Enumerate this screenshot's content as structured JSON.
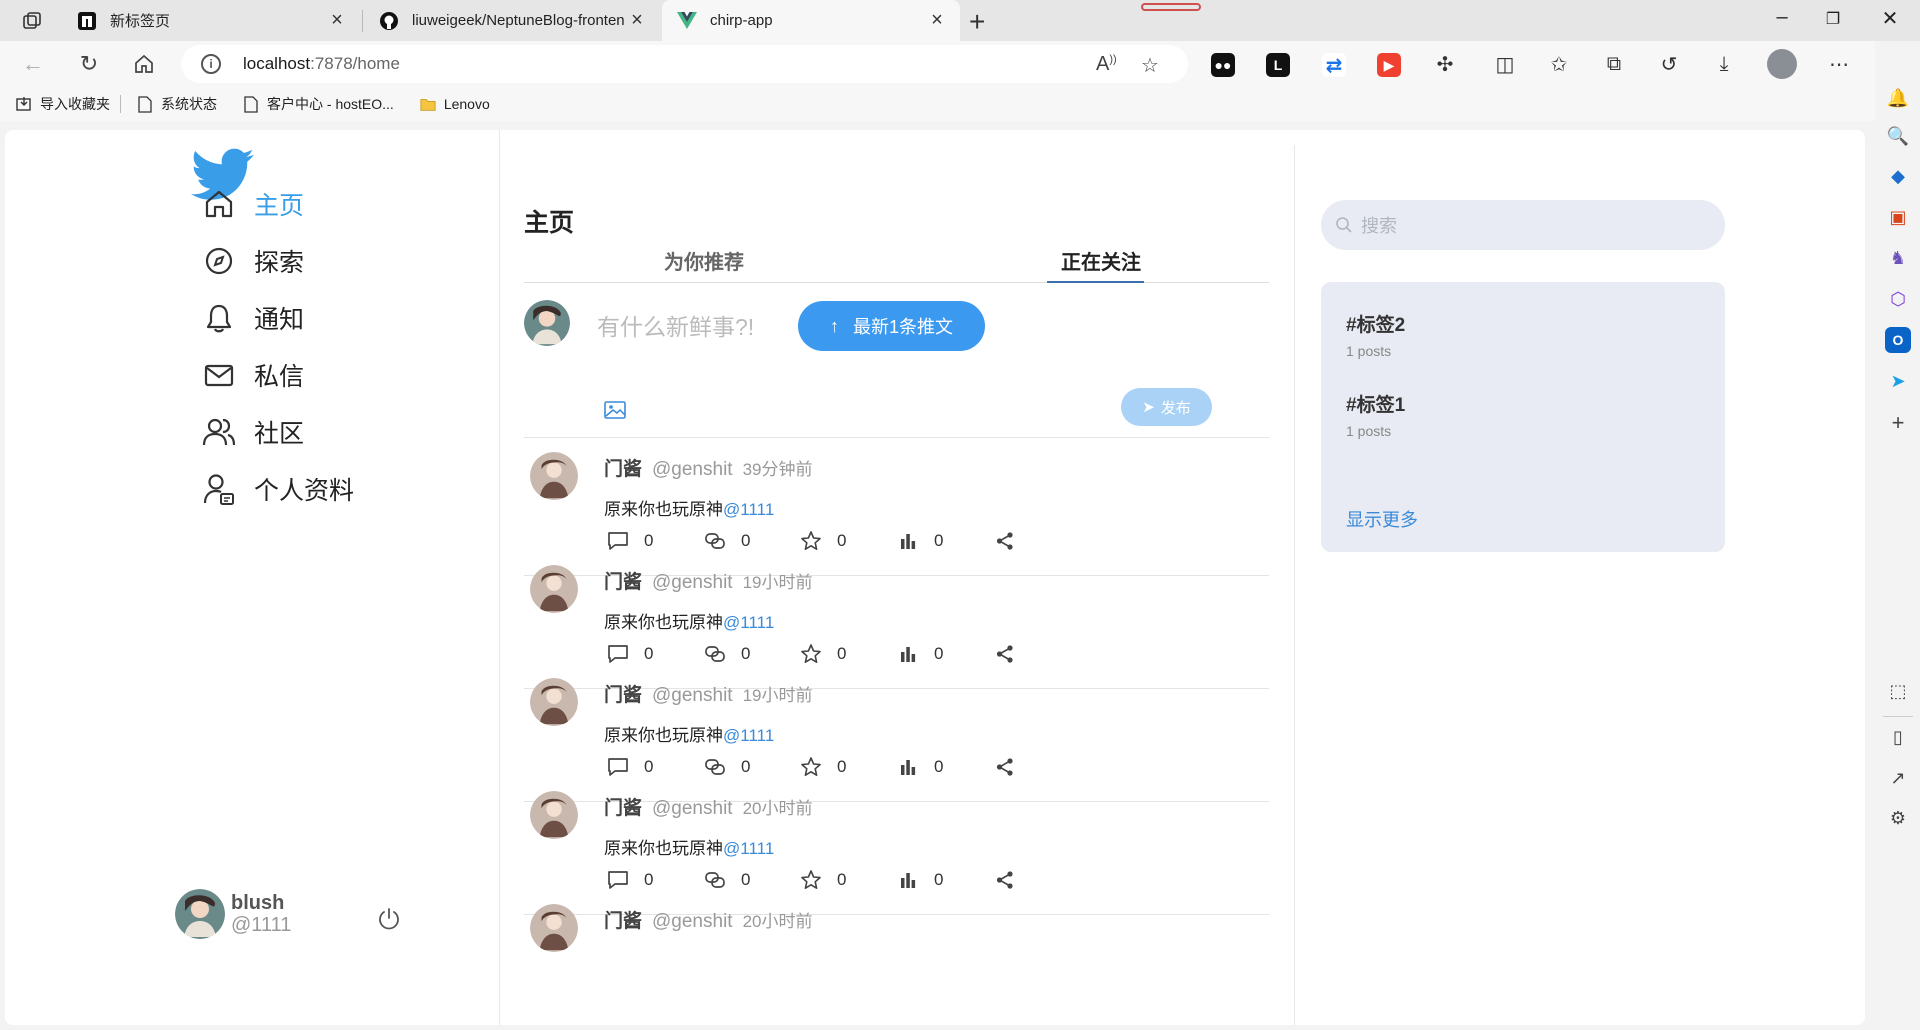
{
  "browser": {
    "tabs": [
      {
        "title": "新标签页",
        "favicon": "edge-newtab-icon"
      },
      {
        "title": "liuweigeek/NeptuneBlog-fronten",
        "favicon": "github-icon"
      },
      {
        "title": "chirp-app",
        "favicon": "vue-icon"
      }
    ],
    "address": {
      "host": "localhost",
      "rest": ":7878/home"
    },
    "bookmarks": [
      {
        "label": "导入收藏夹",
        "icon": "import-icon"
      },
      {
        "label": "系统状态",
        "icon": "page-icon"
      },
      {
        "label": "客户中心 - hostEO...",
        "icon": "page-icon"
      },
      {
        "label": "Lenovo",
        "icon": "folder-icon"
      }
    ]
  },
  "nav": {
    "items": [
      {
        "label": "主页",
        "icon": "home-icon"
      },
      {
        "label": "探索",
        "icon": "compass-icon"
      },
      {
        "label": "通知",
        "icon": "bell-icon"
      },
      {
        "label": "私信",
        "icon": "mail-icon"
      },
      {
        "label": "社区",
        "icon": "users-icon"
      },
      {
        "label": "个人资料",
        "icon": "profile-icon"
      }
    ],
    "user": {
      "name": "blush",
      "handle": "@1111"
    }
  },
  "feed": {
    "title": "主页",
    "tabs": [
      "为你推荐",
      "正在关注"
    ],
    "active_tab": "正在关注",
    "compose_placeholder": "有什么新鲜事?!",
    "new_posts_button": "最新1条推文",
    "publish_button": "发布",
    "posts": [
      {
        "name": "门酱",
        "handle": "@genshit",
        "time": "39分钟前",
        "text": "原来你也玩原神",
        "mention": "@1111",
        "reply": "0",
        "retweet": "0",
        "like": "0",
        "views": "0"
      },
      {
        "name": "门酱",
        "handle": "@genshit",
        "time": "19小时前",
        "text": "原来你也玩原神",
        "mention": "@1111",
        "reply": "0",
        "retweet": "0",
        "like": "0",
        "views": "0"
      },
      {
        "name": "门酱",
        "handle": "@genshit",
        "time": "19小时前",
        "text": "原来你也玩原神",
        "mention": "@1111",
        "reply": "0",
        "retweet": "0",
        "like": "0",
        "views": "0"
      },
      {
        "name": "门酱",
        "handle": "@genshit",
        "time": "20小时前",
        "text": "原来你也玩原神",
        "mention": "@1111",
        "reply": "0",
        "retweet": "0",
        "like": "0",
        "views": "0"
      },
      {
        "name": "门酱",
        "handle": "@genshit",
        "time": "20小时前",
        "text": "",
        "mention": "",
        "reply": "",
        "retweet": "",
        "like": "",
        "views": ""
      }
    ]
  },
  "sidebar": {
    "search_placeholder": "搜索",
    "trends": [
      {
        "tag": "#标签2",
        "count": "1 posts"
      },
      {
        "tag": "#标签1",
        "count": "1 posts"
      }
    ],
    "show_more": "显示更多"
  },
  "colors": {
    "accent": "#3b99f0",
    "link": "#3a8ad8",
    "panel": "#e8ebf3"
  }
}
